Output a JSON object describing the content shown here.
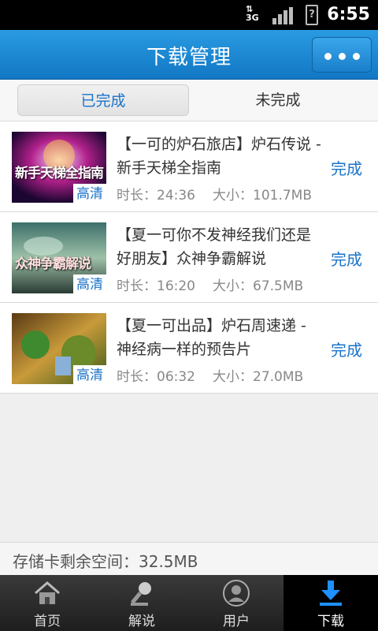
{
  "status_bar": {
    "network": "3G",
    "time": "6:55"
  },
  "header": {
    "title": "下载管理"
  },
  "tabs": [
    {
      "label": "已完成"
    },
    {
      "label": "未完成"
    }
  ],
  "items": [
    {
      "thumb_text": "新手天梯全指南",
      "hd": "高清",
      "title": "【一可的炉石旅店】炉石传说 - 新手天梯全指南",
      "duration": "时长：24:36",
      "size": "大小：101.7MB",
      "status": "完成"
    },
    {
      "thumb_text": "众神争霸解说",
      "hd": "高清",
      "title": "【夏一可你不发神经我们还是好朋友】众神争霸解说",
      "duration": "时长：16:20",
      "size": "大小：67.5MB",
      "status": "完成"
    },
    {
      "thumb_text": "",
      "hd": "高清",
      "title": "【夏一可出品】炉石周速递 - 神经病一样的预告片",
      "duration": "时长：06:32",
      "size": "大小：27.0MB",
      "status": "完成"
    }
  ],
  "storage": {
    "text": "存储卡剩余空间：32.5MB"
  },
  "nav": [
    {
      "label": "首页",
      "icon": "home-icon"
    },
    {
      "label": "解说",
      "icon": "microphone-icon"
    },
    {
      "label": "用户",
      "icon": "user-icon"
    },
    {
      "label": "下载",
      "icon": "download-icon"
    }
  ]
}
